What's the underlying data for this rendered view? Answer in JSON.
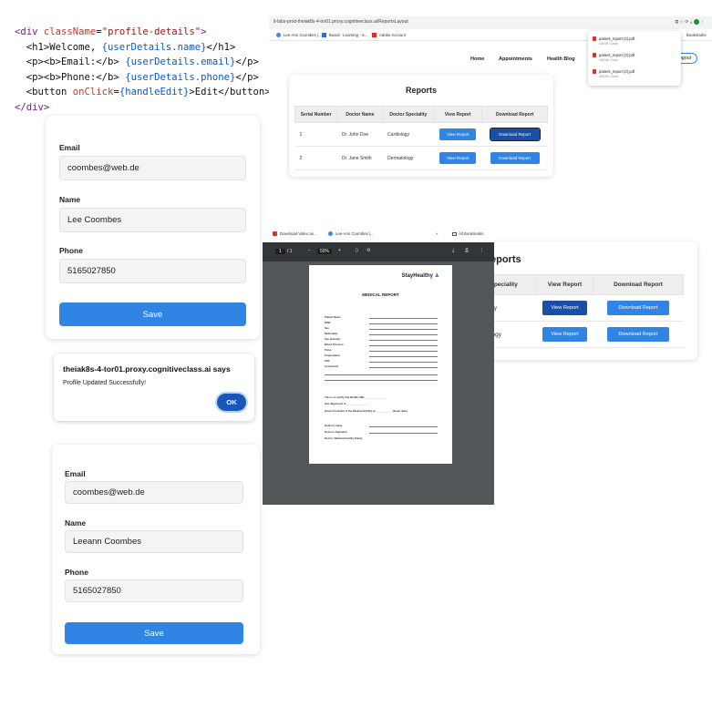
{
  "code": {
    "line1_open": "<div ",
    "line1_attr": "className",
    "line1_eq": "=",
    "line1_str": "\"profile-details\"",
    "line1_close": ">",
    "line2_pre": "  <h1>Welcome, ",
    "line2_expr": "{userDetails.name}",
    "line2_post": "</h1>",
    "line3_pre": "  <p><b>Email:</b> ",
    "line3_expr": "{userDetails.email}",
    "line3_post": "</p>",
    "line4_pre": "  <p><b>Phone:</b> ",
    "line4_expr": "{userDetails.phone}",
    "line4_post": "</p>",
    "line5_pre": "  <button ",
    "line5_attr": "onClick",
    "line5_eq": "=",
    "line5_expr": "{handleEdit}",
    "line5_post": ">Edit</button>",
    "line6": "</div>"
  },
  "form1": {
    "email_label": "Email",
    "email_value": "coombes@web.de",
    "name_label": "Name",
    "name_value": "Lee Coombes",
    "phone_label": "Phone",
    "phone_value": "5165027850",
    "save_label": "Save"
  },
  "alert": {
    "title": "theiak8s-4-tor01.proxy.cognitiveclass.ai says",
    "message": "Profile Updated Successfully!",
    "ok_label": "OK"
  },
  "form2": {
    "email_label": "Email",
    "email_value": "coombes@web.de",
    "name_label": "Name",
    "name_value": "Leeann Coombes",
    "phone_label": "Phone",
    "phone_value": "5165027850",
    "save_label": "Save"
  },
  "browser": {
    "url": "tl-labs-prod-theiak8s-4-tor01.proxy.cognitiveclass.ai/ReportsLayout",
    "bookmarks": [
      "Lee-Ann Coombes |...",
      "Board - Learning - S...",
      "Adobe Account"
    ],
    "bookmarks_right": "Bookmarks",
    "nav": [
      "Home",
      "Appointments",
      "Health Blog"
    ],
    "logout_label": "Logout",
    "downloads": [
      {
        "name": "patient_report (4).pdf",
        "status": "425 kB • Done"
      },
      {
        "name": "patient_report (3).pdf",
        "status": "425 kB • Done"
      },
      {
        "name": "patient_report (2).pdf",
        "status": "425 kB • Done"
      }
    ]
  },
  "reports": {
    "title": "Reports",
    "headers": [
      "Serial Number",
      "Doctor Name",
      "Doctor Speciality",
      "View Report",
      "Download Report"
    ],
    "rows": [
      {
        "serial": "1",
        "doctor": "Dr. John Doe",
        "speciality": "Cardiology",
        "view": "View Report",
        "download": "Download Report"
      },
      {
        "serial": "2",
        "doctor": "Dr. Jane Smith",
        "speciality": "Dermatology",
        "view": "View Report",
        "download": "Download Report"
      }
    ]
  },
  "pdf_viewer": {
    "tabs": [
      "Download Video an...",
      "Lee-Ann Coombes |..."
    ],
    "all_bookmarks": "All Bookmarks",
    "page_indicator": "1",
    "page_total": "/ 1",
    "zoom": "50%",
    "brand": "StayHealthy",
    "doc_title": "MEDICAL REPORT",
    "fields": [
      "Patient Name",
      "DOB",
      "Sex",
      "Nationality",
      "Sex (Gender)",
      "Blood Pressure",
      "Pulse",
      "Temperature",
      "SO2",
      "Conclusion"
    ],
    "certify": "This is to certify that Mr./Mrs./Ms. _______________",
    "diagnosed": "was diagnosed to _______________",
    "hospital": "[Insert the Name of the Medical facility] on ___________ [Insert date]",
    "sign_fields": [
      "Doctor's name",
      "Doctor's Signature",
      "Doctor / Medical Facility Stamp"
    ]
  },
  "reports_zoom": {
    "title_partial": "eports",
    "headers": [
      "r Speciality",
      "View Report",
      "Download Report"
    ],
    "rows": [
      {
        "speciality": "ogy",
        "view": "View Report",
        "download": "Download Report"
      },
      {
        "speciality": "ology",
        "view": "View Report",
        "download": "Download Report"
      }
    ]
  }
}
